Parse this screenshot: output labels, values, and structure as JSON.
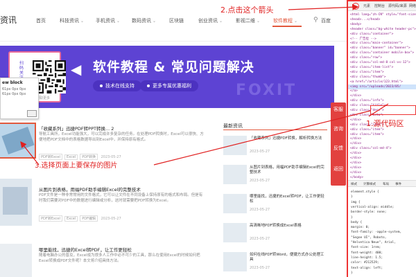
{
  "nav": {
    "brand": "资讯",
    "items": [
      {
        "label": "首页",
        "chevron": false
      },
      {
        "label": "科技资讯",
        "chevron": true
      },
      {
        "label": "手机资讯",
        "chevron": true
      },
      {
        "label": "数码资讯",
        "chevron": true
      },
      {
        "label": "区块链",
        "chevron": false
      },
      {
        "label": "创业资讯",
        "chevron": true
      },
      {
        "label": "影视二维",
        "chevron": true
      },
      {
        "label": "软件教程",
        "chevron": true
      }
    ],
    "active_index": 7,
    "search_label": "百度"
  },
  "banner": {
    "title": "软件教程 & 常见问题解决",
    "pills": [
      "技术在线支持",
      "更多专属优惠福利"
    ],
    "watermark": "FOXIT",
    "qr_vertical": "扫码关注",
    "qr_caption": "扫码获取更多"
  },
  "hover_card": {
    "title": "ew block",
    "lines": [
      "61px 0px 0px",
      "61px 0px 0px"
    ]
  },
  "articles": [
    {
      "title": "「收藏系列」迅捷PDF转PPT转换... 2",
      "desc": "导航工具所，Excel功能强大，可以完成许多复杂的任务。在处理PDF转换时，Excel可以很快、方便地把PDF文档中的表格数据导出到Excel中，并保持原有格式。",
      "date": "2023-05-27",
      "tags": [
        "PDF转Excel",
        "Excel",
        "PDF转换"
      ]
    },
    {
      "title": "从图片到表格，用福PDF助手编辑Excel的完整技术",
      "desc": "PDF文件是一种非常常用的文件格式，它可以让文件在不同设备上保持原有的格式和布局。但是有时我们需要对PDF中的数据进行编辑或分析，这时就需要把PDF转换为Excel。",
      "date": "2023-05-27",
      "tags": [
        "PDF转Excel",
        "Excel",
        "PDF编辑"
      ]
    },
    {
      "title": "哪里能找，迅捷的Excel转PDF，让工作更轻松",
      "desc": "随着电脑办公的普及，Excel成为很多人工作中必不可少的工具，那么在使用Excel的时候如何把Excel转换成PDF文件呢？本文将介绍具体方法。",
      "date": "2023-05-27",
      "tags": [
        "Excel转PDF"
      ]
    }
  ],
  "side": {
    "title": "最新资讯",
    "items": [
      {
        "text": "「收藏系列」迅捷PDF转换，解析转换方法",
        "date": "2023-05-27"
      },
      {
        "text": "从图片到表格，用福PDF助手编辑Excel的完整技术",
        "date": "2023-05-27"
      },
      {
        "text": "哪里能找，迅捷的Excel转PDF，让工作更轻松",
        "date": "2023-05-27"
      },
      {
        "text": "高清晰地PDF转换成Excel表格",
        "date": "2023-05-27"
      },
      {
        "text": "如何在线PDF转Word，便捷方式办公处理工具",
        "date": "2023-05-27"
      }
    ]
  },
  "float_bar": [
    "客服",
    "咨询",
    "反馈",
    "返回"
  ],
  "devtools": {
    "tabs": [
      "元素",
      "控制台",
      "源代码/来源",
      "网络"
    ],
    "lines": [
      "<html lang=\"zh-CN\" style=\"font-size",
      "<head>...</head>",
      "<body>",
      " <header class=\"bg-white header-pc\">",
      "  <div class=\"container\">",
      "  <!-- 广告位 -->",
      "  <div class=\"main-container\">",
      "   <div class=\"banner\" id=\"banner\">",
      "   <div class=\"container mobile-box\">",
      "    <div class=\"row\">",
      "     <div class=\"col-md-8 col-xs-12\">",
      "      <div class=\"item-list\">",
      "       <div class=\"item\">",
      "        <div class=\"thumb\">",
      "         <a href=\"/article/123.html\">",
      "          <img src=\"/uploads/2023/05/",
      "         </a>",
      "        </div>",
      "        <div class=\"info\">",
      "         <div class=\"title\">",
      "         <div class=\"desc\">",
      "         <div class=\"meta\">",
      "        </div>",
      "       <div class=\"item\">",
      "       <div class=\"item\">",
      "       <div class=\"item\">",
      "      </div>",
      "     </div>",
      "     <div class=\"col-md-4\">",
      "     </div>",
      "    </div>",
      "   </div>",
      "  </div>",
      " </div>",
      "</body>"
    ],
    "highlight_index": 15,
    "styles_tabs": [
      "样式",
      "计算样式",
      "布局",
      "事件"
    ],
    "css_lines": [
      "element.style {",
      "}",
      "img {",
      "  vertical-align: middle;",
      "  border-style: none;",
      "}",
      "body {",
      "  margin: 0;",
      "  font-family: -apple-system,",
      "  \"Segoe UI\", Roboto,",
      "  \"Helvetica Neue\", Arial,",
      "  font-size: 1rem;",
      "  font-weight: 400;",
      "  line-height: 1.5;",
      "  color: #212529;",
      "  text-align: left;",
      "}"
    ]
  },
  "annotations": {
    "step1": "1.源代码区",
    "step2": "2.点击这个箭头",
    "step3": "3.选择页面上要保存的图片"
  },
  "colors": {
    "accent": "#e2583c",
    "banner": "#5d43d3",
    "annotation": "#e02020",
    "devtools_highlight": "#cfe3fb"
  }
}
